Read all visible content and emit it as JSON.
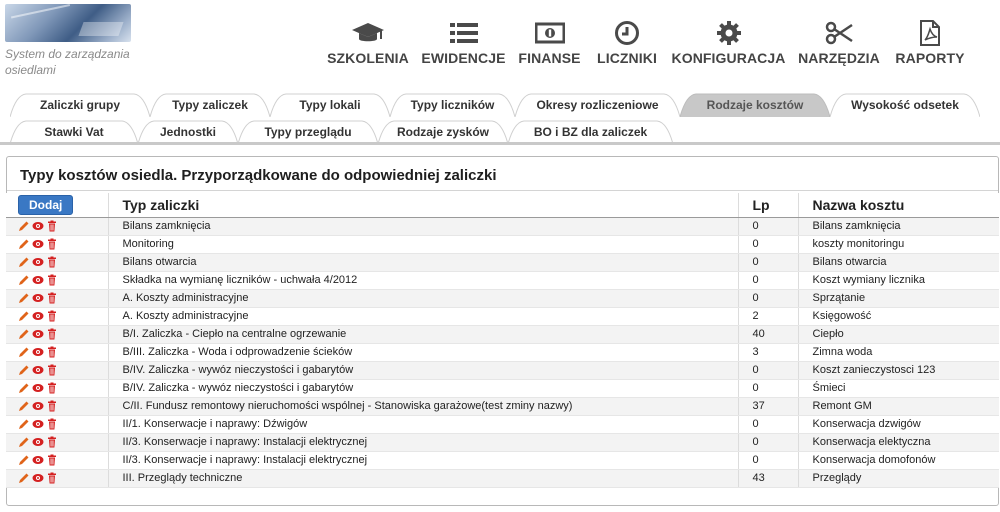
{
  "header": {
    "logo_text": "System do zarządzania osiedlami",
    "nav": [
      {
        "label": "SZKOLENIA",
        "icon": "graduation-cap-icon"
      },
      {
        "label": "EWIDENCJE",
        "icon": "list-icon"
      },
      {
        "label": "FINANSE",
        "icon": "money-icon"
      },
      {
        "label": "LICZNIKI",
        "icon": "clock-icon"
      },
      {
        "label": "KONFIGURACJA",
        "icon": "gear-icon"
      },
      {
        "label": "NARZĘDZIA",
        "icon": "scissors-icon"
      },
      {
        "label": "RAPORTY",
        "icon": "pdf-file-icon"
      }
    ]
  },
  "tabs": {
    "row1": [
      "Zaliczki grupy",
      "Typy zaliczek",
      "Typy lokali",
      "Typy liczników",
      "Okresy rozliczeniowe",
      "Rodzaje kosztów",
      "Wysokość odsetek"
    ],
    "row2": [
      "Stawki Vat",
      "Jednostki",
      "Typy przeglądu",
      "Rodzaje zysków",
      "BO i BZ dla zaliczek"
    ],
    "active": "Rodzaje kosztów"
  },
  "panel": {
    "title": "Typy kosztów osiedla. Przyporządkowane do odpowiedniej zaliczki",
    "add_button": "Dodaj",
    "columns": {
      "typ": "Typ zaliczki",
      "lp": "Lp",
      "nazwa": "Nazwa kosztu"
    },
    "rows": [
      {
        "typ": "Bilans zamknięcia",
        "lp": "0",
        "nazwa": "Bilans zamknięcia"
      },
      {
        "typ": "Monitoring",
        "lp": "0",
        "nazwa": "koszty monitoringu"
      },
      {
        "typ": "Bilans otwarcia",
        "lp": "0",
        "nazwa": "Bilans otwarcia"
      },
      {
        "typ": "Składka na wymianę liczników - uchwała 4/2012",
        "lp": "0",
        "nazwa": "Koszt wymiany licznika"
      },
      {
        "typ": "A. Koszty administracyjne",
        "lp": "0",
        "nazwa": "Sprzątanie"
      },
      {
        "typ": "A. Koszty administracyjne",
        "lp": "2",
        "nazwa": "Księgowość"
      },
      {
        "typ": "B/I. Zaliczka - Ciepło na centralne ogrzewanie",
        "lp": "40",
        "nazwa": "Ciepło"
      },
      {
        "typ": "B/III. Zaliczka - Woda i odprowadzenie ścieków",
        "lp": "3",
        "nazwa": "Zimna woda"
      },
      {
        "typ": "B/IV. Zaliczka - wywóz nieczystości i gabarytów",
        "lp": "0",
        "nazwa": "Koszt zanieczystosci 123"
      },
      {
        "typ": "B/IV. Zaliczka - wywóz nieczystości i gabarytów",
        "lp": "0",
        "nazwa": "Śmieci"
      },
      {
        "typ": "C/II. Fundusz remontowy nieruchomości wspólnej - Stanowiska garażowe(test zminy nazwy)",
        "lp": "37",
        "nazwa": "Remont GM"
      },
      {
        "typ": "II/1. Konserwacje i naprawy: Dźwigów",
        "lp": "0",
        "nazwa": "Konserwacja dzwigów"
      },
      {
        "typ": "II/3. Konserwacje i naprawy: Instalacji elektrycznej",
        "lp": "0",
        "nazwa": "Konserwacja elektyczna"
      },
      {
        "typ": "II/3. Konserwacje i naprawy: Instalacji elektrycznej",
        "lp": "0",
        "nazwa": "Konserwacja domofonów"
      },
      {
        "typ": "III. Przeglądy techniczne",
        "lp": "43",
        "nazwa": "Przeglądy"
      }
    ]
  },
  "colors": {
    "accent": "#3a78c4",
    "edit_icon": "#e0641a",
    "view_icon": "#d42020",
    "delete_icon": "#d42020"
  }
}
